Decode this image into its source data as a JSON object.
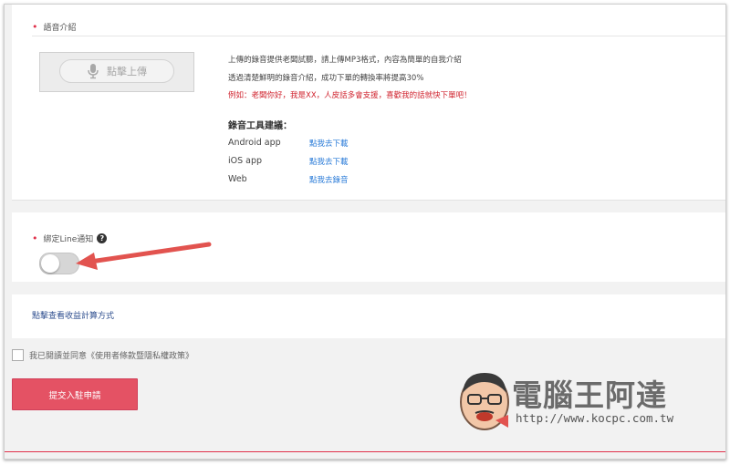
{
  "voice": {
    "title": "語音介紹",
    "upload_label": "點擊上傳",
    "desc_line1": "上傳的錄音提供老闆試聽，請上傳MP3格式，內容為簡單的自我介紹",
    "desc_line2": "透過清楚鮮明的錄音介紹，成功下單的轉換率將提高30%",
    "desc_example": "例如：老闆你好，我是XX，人皮話多會支援，喜歡我的話就快下單吧！",
    "tools_title": "錄音工具建議：",
    "tools": [
      {
        "name": "Android app",
        "link": "點我去下載"
      },
      {
        "name": "iOS app",
        "link": "點我去下載"
      },
      {
        "name": "Web",
        "link": "點我去錄音"
      }
    ]
  },
  "line": {
    "title": "綁定Line通知",
    "help": "?",
    "toggle_on": false
  },
  "earnings_link": "點擊查看收益計算方式",
  "agree_text": "我已閱讀並同意《使用者條款暨隱私權政策》",
  "submit_label": "提交入駐申請",
  "watermark": {
    "name": "電腦王阿達",
    "url": "http://www.kocpc.com.tw"
  },
  "colors": {
    "accent": "#e45264",
    "link": "#2a7bd8",
    "required": "#e0314b",
    "arrow": "#e2534f"
  }
}
